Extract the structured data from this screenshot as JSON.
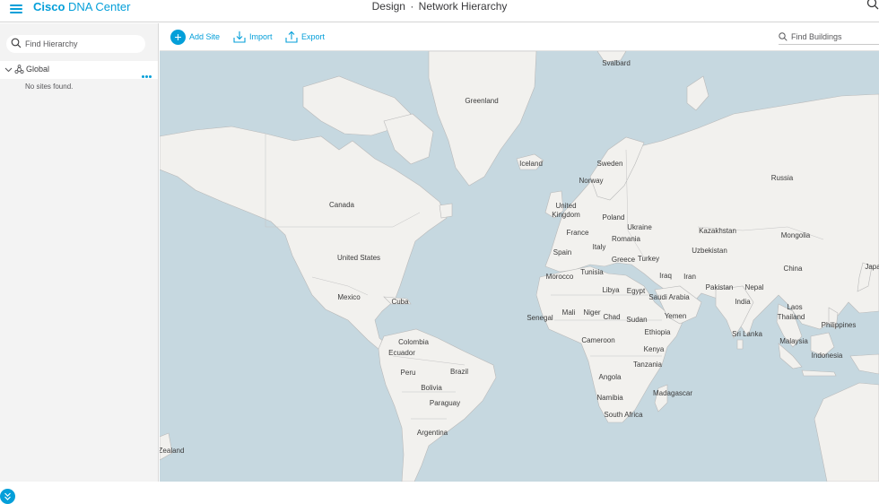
{
  "header": {
    "brand_bold": "Cisco",
    "brand_rest": "DNA Center",
    "section": "Design",
    "separator": "·",
    "page": "Network Hierarchy"
  },
  "sidebar": {
    "search_placeholder": "Find Hierarchy",
    "tree_root": "Global",
    "empty_message": "No sites found."
  },
  "toolbar": {
    "add_label": "Add Site",
    "import_label": "Import",
    "export_label": "Export",
    "find_placeholder": "Find Buildings"
  },
  "map_labels": {
    "svalbard": "Svalbard",
    "greenland": "Greenland",
    "iceland": "Iceland",
    "sweden": "Sweden",
    "norway": "Norway",
    "russia": "Russia",
    "canada": "Canada",
    "uk": "United Kingdom",
    "poland": "Poland",
    "ukraine": "Ukraine",
    "kazakhstan": "Kazakhstan",
    "mongolia": "Mongolia",
    "france": "France",
    "romania": "Romania",
    "uzbekistan": "Uzbekistan",
    "italy": "Italy",
    "usa": "United States",
    "spain": "Spain",
    "greece": "Greece",
    "turkey": "Turkey",
    "china": "China",
    "japan": "Japa",
    "tunisia": "Tunisia",
    "iraq": "Iraq",
    "iran": "Iran",
    "morocco": "Morocco",
    "pakistan": "Pakistan",
    "nepal": "Nepal",
    "mexico": "Mexico",
    "libya": "Libya",
    "egypt": "Egypt",
    "saudi": "Saudi Arabia",
    "cuba": "Cuba",
    "india": "India",
    "laos": "Laos",
    "mali": "Mali",
    "niger": "Niger",
    "chad": "Chad",
    "sudan": "Sudan",
    "yemen": "Yemen",
    "senegal": "Senegal",
    "thailand": "Thailand",
    "philippines": "Philippines",
    "ethiopia": "Ethiopia",
    "srilanka": "Sri Lanka",
    "cameroon": "Cameroon",
    "malaysia": "Malaysia",
    "colombia": "Colombia",
    "kenya": "Kenya",
    "ecuador": "Ecuador",
    "indonesia": "Indonesia",
    "brazil": "Brazil",
    "tanzania": "Tanzania",
    "peru": "Peru",
    "angola": "Angola",
    "madagascar": "Madagascar",
    "bolivia": "Bolivia",
    "namibia": "Namibia",
    "paraguay": "Paraguay",
    "southafrica": "South Africa",
    "argentina": "Argentina",
    "zealand": "Zealand"
  },
  "colors": {
    "accent": "#049fd9",
    "ocean": "#c6d8e0",
    "land": "#f2f1ee",
    "border": "#b9b9b9"
  }
}
